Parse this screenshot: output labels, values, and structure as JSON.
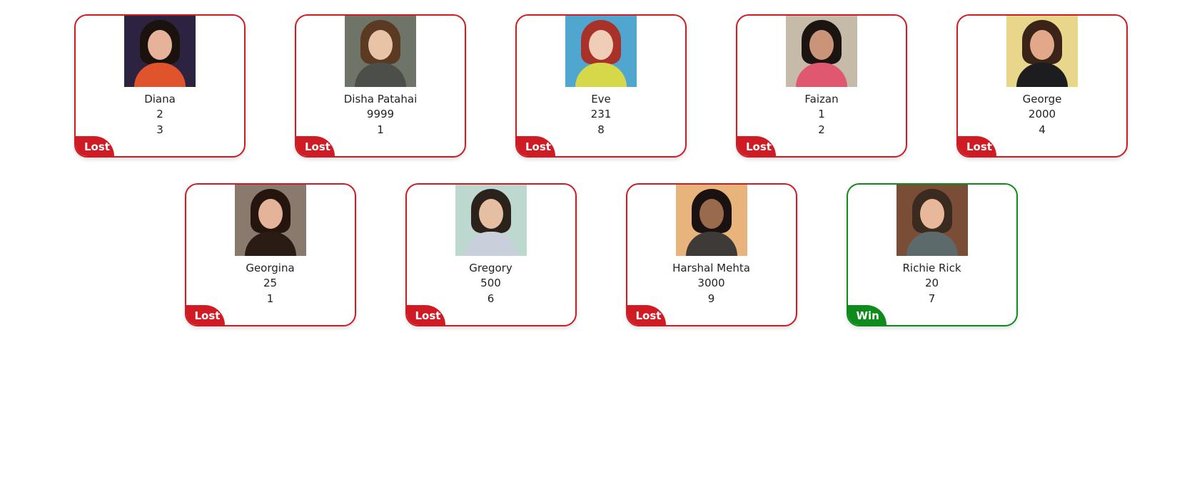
{
  "players": [
    {
      "name": "Diana",
      "stat1": "2",
      "stat2": "3",
      "result": "Lost",
      "avatar_icon": "person-photo-icon",
      "colors": {
        "bg": "#2b2340",
        "hair": "#1b120e",
        "face": "#e6b39a",
        "torso": "#e0542c"
      }
    },
    {
      "name": "Disha Patahai",
      "stat1": "9999",
      "stat2": "1",
      "result": "Lost",
      "avatar_icon": "person-photo-icon",
      "colors": {
        "bg": "#6f7468",
        "hair": "#5a3a22",
        "face": "#e9c3a6",
        "torso": "#4c4e4a"
      }
    },
    {
      "name": "Eve",
      "stat1": "231",
      "stat2": "8",
      "result": "Lost",
      "avatar_icon": "person-photo-icon",
      "colors": {
        "bg": "#4fa6cf",
        "hair": "#a8322a",
        "face": "#f0cdb7",
        "torso": "#d6d84a"
      }
    },
    {
      "name": "Faizan",
      "stat1": "1",
      "stat2": "2",
      "result": "Lost",
      "avatar_icon": "person-photo-icon",
      "colors": {
        "bg": "#c6bba8",
        "hair": "#1c1410",
        "face": "#c99478",
        "torso": "#e05870"
      }
    },
    {
      "name": "George",
      "stat1": "2000",
      "stat2": "4",
      "result": "Lost",
      "avatar_icon": "person-photo-icon",
      "colors": {
        "bg": "#e8d68a",
        "hair": "#3a2418",
        "face": "#e2a889",
        "torso": "#1d1d1f"
      }
    },
    {
      "name": "Georgina",
      "stat1": "25",
      "stat2": "1",
      "result": "Lost",
      "avatar_icon": "person-photo-icon",
      "colors": {
        "bg": "#8a7a6e",
        "hair": "#24150f",
        "face": "#e4b39a",
        "torso": "#2a1b15"
      }
    },
    {
      "name": "Gregory",
      "stat1": "500",
      "stat2": "6",
      "result": "Lost",
      "avatar_icon": "person-photo-icon",
      "colors": {
        "bg": "#bcd8cf",
        "hair": "#2c221c",
        "face": "#e6bea2",
        "torso": "#c8d0dc"
      }
    },
    {
      "name": "Harshal Mehta",
      "stat1": "3000",
      "stat2": "9",
      "result": "Lost",
      "avatar_icon": "person-photo-icon",
      "colors": {
        "bg": "#e8b47c",
        "hair": "#1a1210",
        "face": "#9a6a4c",
        "torso": "#3d3a38"
      }
    },
    {
      "name": "Richie Rick",
      "stat1": "20",
      "stat2": "7",
      "result": "Win",
      "avatar_icon": "person-photo-icon",
      "colors": {
        "bg": "#7a4e36",
        "hair": "#3a2a20",
        "face": "#e7b89a",
        "torso": "#5d6a6c"
      }
    }
  ],
  "status_colors": {
    "Lost": "#cf1b23",
    "Win": "#0f8a1c"
  }
}
